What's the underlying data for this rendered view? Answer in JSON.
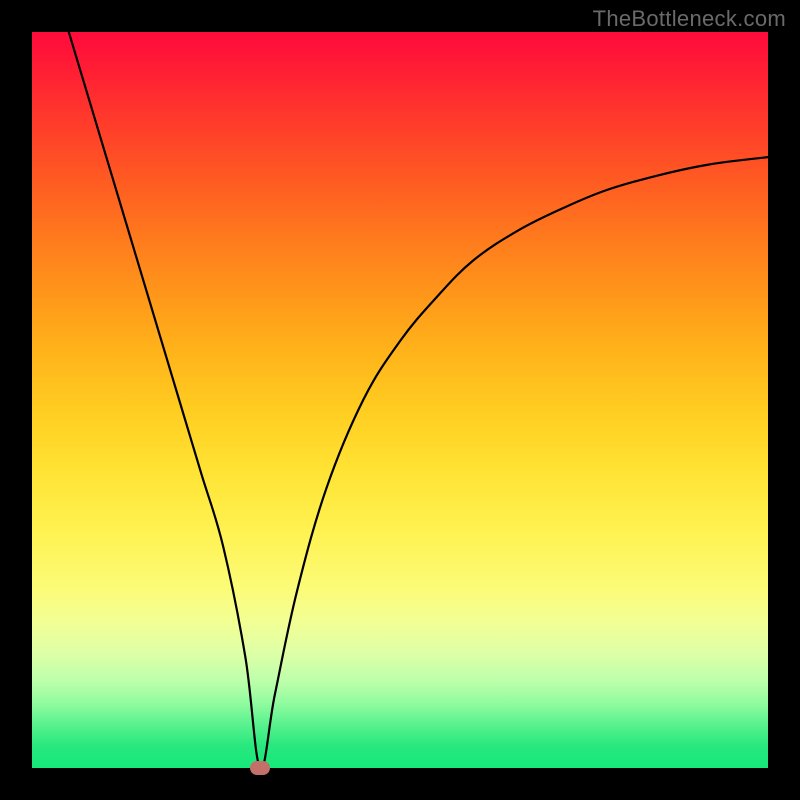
{
  "watermark": "TheBottleneck.com",
  "colors": {
    "frame": "#000000",
    "curve": "#000000",
    "marker": "#c36f6a"
  },
  "chart_data": {
    "type": "line",
    "title": "",
    "xlabel": "",
    "ylabel": "",
    "xlim": [
      0,
      100
    ],
    "ylim": [
      0,
      100
    ],
    "grid": false,
    "legend": false,
    "annotations": [
      {
        "label": "watermark",
        "text": "TheBottleneck.com",
        "position": "top-right"
      }
    ],
    "marker": {
      "x": 31,
      "y": 0,
      "shape": "oval",
      "color": "#c36f6a"
    },
    "series": [
      {
        "name": "bottleneck-curve",
        "x": [
          5,
          8,
          11,
          14,
          17,
          20,
          23,
          26,
          29,
          31,
          33,
          36,
          40,
          45,
          50,
          55,
          60,
          66,
          72,
          78,
          85,
          92,
          100
        ],
        "y": [
          100,
          90,
          80,
          70,
          60,
          50,
          40,
          30,
          15,
          0,
          10,
          24,
          38,
          50,
          58,
          64,
          69,
          73,
          76,
          78.5,
          80.5,
          82,
          83
        ]
      }
    ],
    "background_gradient": {
      "direction": "vertical",
      "stops": [
        {
          "pos": 0.0,
          "color": "#ff0b3c"
        },
        {
          "pos": 0.5,
          "color": "#ffcf22"
        },
        {
          "pos": 0.75,
          "color": "#fcfb74"
        },
        {
          "pos": 1.0,
          "color": "#15e879"
        }
      ]
    }
  }
}
